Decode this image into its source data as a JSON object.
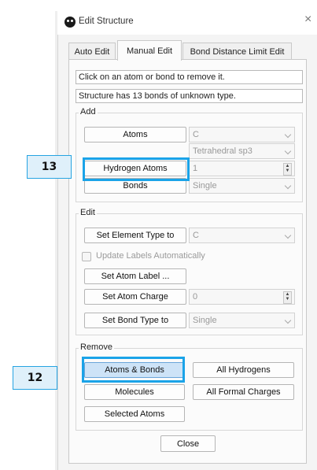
{
  "window": {
    "title": "Edit Structure"
  },
  "tabs": [
    "Auto Edit",
    "Manual Edit",
    "Bond Distance Limit Edit"
  ],
  "info": {
    "instruction": "Click on an atom or bond to remove it.",
    "status": "Structure has 13 bonds of unknown type."
  },
  "add": {
    "title": "Add",
    "atoms_label": "Atoms",
    "atoms_value": "C",
    "geometry_value": "Tetrahedral sp3",
    "hydrogen_label": "Hydrogen Atoms",
    "hydrogen_value": "1",
    "bonds_label": "Bonds",
    "bonds_value": "Single"
  },
  "edit": {
    "title": "Edit",
    "set_element_label": "Set Element Type to",
    "set_element_value": "C",
    "update_labels": "Update Labels Automatically",
    "set_atom_label": "Set Atom Label ...",
    "set_charge_label": "Set Atom Charge",
    "set_charge_value": "0",
    "set_bond_type_label": "Set Bond Type to",
    "set_bond_type_value": "Single"
  },
  "remove": {
    "title": "Remove",
    "atoms_bonds": "Atoms & Bonds",
    "all_hydrogens": "All Hydrogens",
    "molecules": "Molecules",
    "all_formal_charges": "All Formal Charges",
    "selected_atoms": "Selected Atoms"
  },
  "close_label": "Close",
  "callouts": [
    "13",
    "12"
  ],
  "colors": {
    "highlight": "#1aa3e8",
    "pressed": "#cde3f7"
  }
}
